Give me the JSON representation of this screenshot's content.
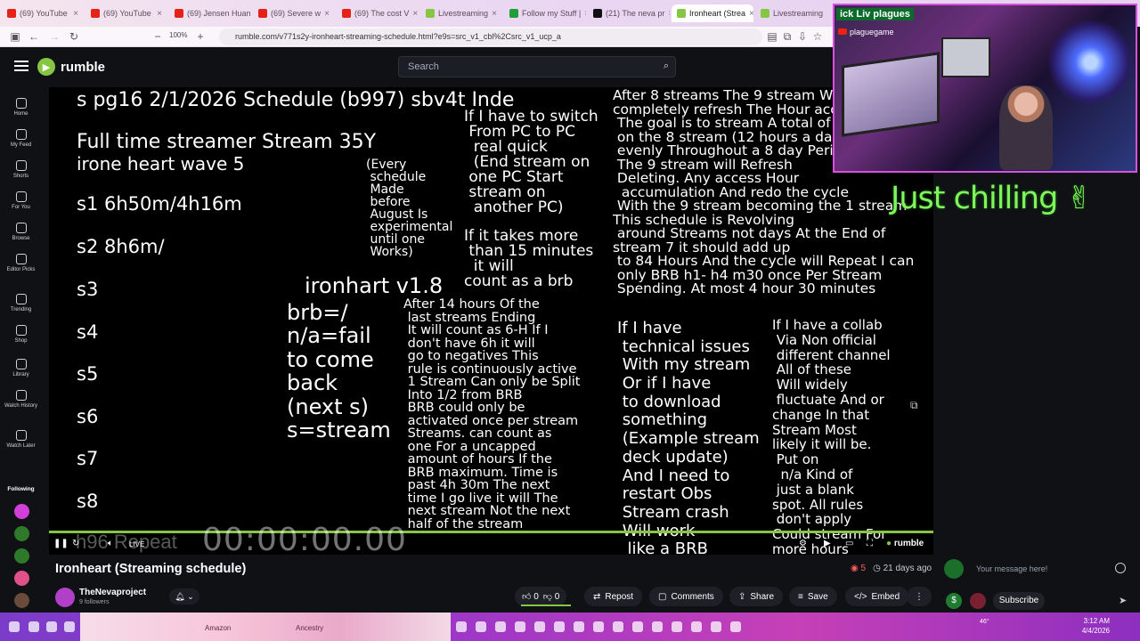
{
  "browser": {
    "tabs": [
      {
        "title": "(69) YouTube",
        "color": "#e62117"
      },
      {
        "title": "(69) YouTube",
        "color": "#e62117"
      },
      {
        "title": "(69) Jensen Huan",
        "color": "#e62117"
      },
      {
        "title": "(69) Severe w",
        "color": "#e62117"
      },
      {
        "title": "(69) The cost V",
        "color": "#e62117"
      },
      {
        "title": "Livestreaming",
        "color": "#85c742"
      },
      {
        "title": "Follow my Stuff |",
        "color": "#1f9e3b"
      },
      {
        "title": "(21) The neva pr",
        "color": "#111111"
      },
      {
        "title": "Ironheart (Strea",
        "color": "#85c742",
        "active": true
      },
      {
        "title": "Livestreaming",
        "color": "#85c742"
      }
    ],
    "zoom": "100%",
    "url": "rumble.com/v771s2y-ironheart-streaming-schedule.html?e9s=src_v1_cbl%2Csrc_v1_ucp_a"
  },
  "site": {
    "logo_text": "rumble",
    "search_placeholder": "Search"
  },
  "sidebar": {
    "items": [
      {
        "label": "Home",
        "icon": "home-icon"
      },
      {
        "label": "My Feed",
        "icon": "feed-icon"
      },
      {
        "label": "Shorts",
        "icon": "shorts-icon"
      },
      {
        "label": "For You",
        "icon": "for-you-icon"
      },
      {
        "label": "Browse",
        "icon": "browse-icon"
      },
      {
        "label": "Editor Picks",
        "icon": "editor-picks-icon"
      },
      {
        "label": "Trending",
        "icon": "trending-icon"
      },
      {
        "label": "Shop",
        "icon": "shop-icon"
      },
      {
        "label": "Library",
        "icon": "library-icon"
      },
      {
        "label": "Watch History",
        "icon": "history-icon"
      },
      {
        "label": "Watch Later",
        "icon": "watch-later-icon"
      }
    ],
    "following_label": "Following",
    "following_colors": [
      "#d23fd6",
      "#2f7a2a",
      "#2f7a2a",
      "#e0508a",
      "#6a4b3a"
    ]
  },
  "video": {
    "schedule_header": "s pg16 2/1/2026 Schedule (b997) sbv4t Inde",
    "full_time": "Full time streamer Stream 35Y",
    "wave": "irone heart wave 5",
    "slots": [
      "s1 6h50m/4h16m",
      "s2 8h6m/",
      "s3",
      "s4",
      "s5",
      "s6",
      "s7",
      "s8"
    ],
    "every_schedule": "(Every\n schedule\n Made\n before\n August Is\n experimental\n until one\n Works)",
    "switch_pc": "If I have to switch\n From PC to PC\n  real quick\n  (End stream on\n one PC Start\n stream on\n  another PC)",
    "fifteen_min": "If it takes more\n than 15 minutes\n  it will\ncount as a brb",
    "version": "ironhart v1.8",
    "legend": "brb=/\nn/a=fail\nto come\nback\n(next s)\ns=stream",
    "after_14": "After 14 hours Of the\n last streams Ending\n It will count as 6-H If I\n don't have 6h it will\n go to negatives This\n rule is continuously active\n 1 Stream Can only be Split\n Into 1/2 from BRB\n BRB could only be\n activated once per stream\n Streams. can count as\n one For a uncapped\n amount of hours If the\n BRB maximum. Time is\n past 4h 30m The next\n time I go live it will The\n next stream Not the next\n half of the stream",
    "after_8": "After 8 streams The 9 stream W\ncompletely refresh The Hour acc\n The goal is to stream A total of\n on the 8 stream (12 hours a day\n evenly Throughout a 8 day Peri\n The 9 stream will Refresh\n Deleting. Any access Hour\n  accumulation And redo the cycle\n With the 9 stream becoming the 1 stream\nThis schedule is Revolving\n around Streams not days At the End of\nstream 7 it should add up\n to 84 Hours And the cycle will Repeat I can\n only BRB h1- h4 m30 once Per Stream\n Spending. At most 4 hour 30 minutes",
    "tech_issues": "If I have\n technical issues\n With my stream\n Or if I have\n to download\n something\n (Example stream\n deck update)\n And I need to\n restart Obs\n Stream crash\n Will work\n  like a BRB",
    "collab": "If I have a collab\n Via Non official\n different channel\n All of these\n Will widely\n fluctuate And or\nchange In that\nStream Most\nlikely it will be.\n Put on\n  n/a Kind of\n just a blank\nspot. All rules\n don't apply\nCould stream For\nmore hours",
    "timecode": "00:00:00.00",
    "repeat_ghost": "h96 Repeat",
    "live_label": "LIVE",
    "player_logo": "rumble"
  },
  "overlay": {
    "cam_name": "ick Liv plagues",
    "cam_sub": "plaguegame",
    "chilling": "Just chilling ✌"
  },
  "meta": {
    "title": "Ironheart (Streaming schedule)",
    "live_viewers": "5",
    "age": "21 days ago",
    "channel_name": "TheNevaproject",
    "followers": "9 followers",
    "likes": "0",
    "dislikes": "0",
    "repost": "Repost",
    "comments": "Comments",
    "share": "Share",
    "save": "Save",
    "embed": "Embed"
  },
  "chat": {
    "placeholder": "Your message here!",
    "subscribe": "Subscribe"
  },
  "taskbar": {
    "labels": [
      "Amazon",
      "Ancestry"
    ],
    "weather": "46°",
    "time": "3:12 AM",
    "date": "4/4/2026"
  },
  "colors": {
    "rumble_green": "#85c742",
    "chilling_green": "#7ef55b",
    "webcam_border": "#d94fe0"
  }
}
